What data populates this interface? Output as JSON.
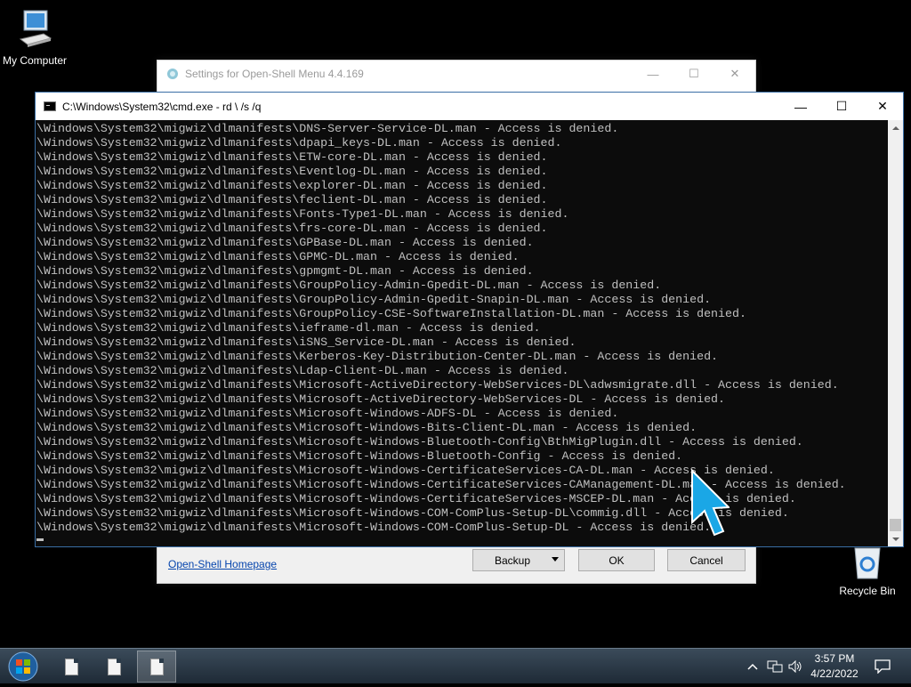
{
  "desktop": {
    "my_computer_label": "My Computer",
    "recycle_bin_label": "Recycle Bin"
  },
  "settings_window": {
    "title": "Settings for Open-Shell Menu 4.4.169",
    "homepage_link": "Open-Shell Homepage",
    "backup_label": "Backup",
    "ok_label": "OK",
    "cancel_label": "Cancel"
  },
  "cmd_window": {
    "title": "C:\\Windows\\System32\\cmd.exe - rd  \\ /s /q",
    "lines": [
      "\\Windows\\System32\\migwiz\\dlmanifests\\DNS-Server-Service-DL.man - Access is denied.",
      "\\Windows\\System32\\migwiz\\dlmanifests\\dpapi_keys-DL.man - Access is denied.",
      "\\Windows\\System32\\migwiz\\dlmanifests\\ETW-core-DL.man - Access is denied.",
      "\\Windows\\System32\\migwiz\\dlmanifests\\Eventlog-DL.man - Access is denied.",
      "\\Windows\\System32\\migwiz\\dlmanifests\\explorer-DL.man - Access is denied.",
      "\\Windows\\System32\\migwiz\\dlmanifests\\feclient-DL.man - Access is denied.",
      "\\Windows\\System32\\migwiz\\dlmanifests\\Fonts-Type1-DL.man - Access is denied.",
      "\\Windows\\System32\\migwiz\\dlmanifests\\frs-core-DL.man - Access is denied.",
      "\\Windows\\System32\\migwiz\\dlmanifests\\GPBase-DL.man - Access is denied.",
      "\\Windows\\System32\\migwiz\\dlmanifests\\GPMC-DL.man - Access is denied.",
      "\\Windows\\System32\\migwiz\\dlmanifests\\gpmgmt-DL.man - Access is denied.",
      "\\Windows\\System32\\migwiz\\dlmanifests\\GroupPolicy-Admin-Gpedit-DL.man - Access is denied.",
      "\\Windows\\System32\\migwiz\\dlmanifests\\GroupPolicy-Admin-Gpedit-Snapin-DL.man - Access is denied.",
      "\\Windows\\System32\\migwiz\\dlmanifests\\GroupPolicy-CSE-SoftwareInstallation-DL.man - Access is denied.",
      "\\Windows\\System32\\migwiz\\dlmanifests\\ieframe-dl.man - Access is denied.",
      "\\Windows\\System32\\migwiz\\dlmanifests\\iSNS_Service-DL.man - Access is denied.",
      "\\Windows\\System32\\migwiz\\dlmanifests\\Kerberos-Key-Distribution-Center-DL.man - Access is denied.",
      "\\Windows\\System32\\migwiz\\dlmanifests\\Ldap-Client-DL.man - Access is denied.",
      "\\Windows\\System32\\migwiz\\dlmanifests\\Microsoft-ActiveDirectory-WebServices-DL\\adwsmigrate.dll - Access is denied.",
      "\\Windows\\System32\\migwiz\\dlmanifests\\Microsoft-ActiveDirectory-WebServices-DL - Access is denied.",
      "\\Windows\\System32\\migwiz\\dlmanifests\\Microsoft-Windows-ADFS-DL - Access is denied.",
      "\\Windows\\System32\\migwiz\\dlmanifests\\Microsoft-Windows-Bits-Client-DL.man - Access is denied.",
      "\\Windows\\System32\\migwiz\\dlmanifests\\Microsoft-Windows-Bluetooth-Config\\BthMigPlugin.dll - Access is denied.",
      "\\Windows\\System32\\migwiz\\dlmanifests\\Microsoft-Windows-Bluetooth-Config - Access is denied.",
      "\\Windows\\System32\\migwiz\\dlmanifests\\Microsoft-Windows-CertificateServices-CA-DL.man - Access is denied.",
      "\\Windows\\System32\\migwiz\\dlmanifests\\Microsoft-Windows-CertificateServices-CAManagement-DL.man - Access is denied.",
      "\\Windows\\System32\\migwiz\\dlmanifests\\Microsoft-Windows-CertificateServices-MSCEP-DL.man - Access is denied.",
      "\\Windows\\System32\\migwiz\\dlmanifests\\Microsoft-Windows-COM-ComPlus-Setup-DL\\commig.dll - Access is denied.",
      "\\Windows\\System32\\migwiz\\dlmanifests\\Microsoft-Windows-COM-ComPlus-Setup-DL - Access is denied."
    ]
  },
  "taskbar": {
    "time": "3:57 PM",
    "date": "4/22/2022"
  },
  "colors": {
    "console_bg": "#0c0c0c",
    "console_text": "#c0c0c0",
    "cursor_arrow": "#1aa7e6",
    "link": "#0645ad"
  }
}
